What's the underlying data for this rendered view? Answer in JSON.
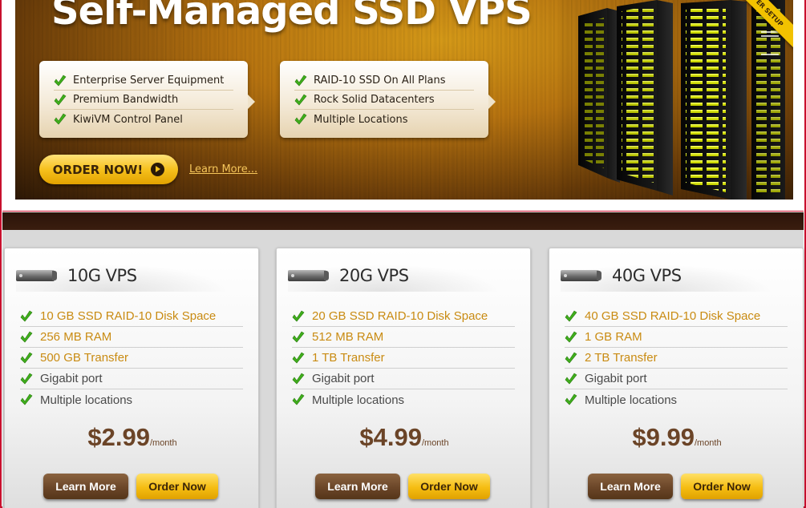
{
  "hero": {
    "title": "Self-Managed SSD VPS",
    "ribbon_text": "ER SETUP",
    "features_left": [
      "Enterprise Server Equipment",
      "Premium Bandwidth",
      "KiwiVM Control Panel"
    ],
    "features_right": [
      "RAID-10 SSD On All Plans",
      "Rock Solid Datacenters",
      "Multiple Locations"
    ],
    "order_button": "ORDER NOW!",
    "learn_more_link": "Learn More..."
  },
  "plans": [
    {
      "name": "10G VPS",
      "features": [
        "10 GB SSD RAID-10 Disk Space",
        "256 MB RAM",
        "500 GB Transfer",
        "Gigabit port",
        "Multiple locations"
      ],
      "price": "$2.99",
      "period": "/month",
      "learn_label": "Learn More",
      "order_label": "Order Now"
    },
    {
      "name": "20G VPS",
      "features": [
        "20 GB SSD RAID-10 Disk Space",
        "512 MB RAM",
        "1 TB Transfer",
        "Gigabit port",
        "Multiple locations"
      ],
      "price": "$4.99",
      "period": "/month",
      "learn_label": "Learn More",
      "order_label": "Order Now"
    },
    {
      "name": "40G VPS",
      "features": [
        "40 GB SSD RAID-10 Disk Space",
        "1 GB RAM",
        "2 TB Transfer",
        "Gigabit port",
        "Multiple locations"
      ],
      "price": "$9.99",
      "period": "/month",
      "learn_label": "Learn More",
      "order_label": "Order Now"
    }
  ],
  "icons": {
    "check": "check-icon",
    "drive": "hard-drive-icon",
    "play": "play-icon"
  },
  "colors": {
    "accent_gold": "#f6c11d",
    "brown": "#6b4628",
    "highlight_text": "#c98b12",
    "frame_red": "#c8102e"
  }
}
